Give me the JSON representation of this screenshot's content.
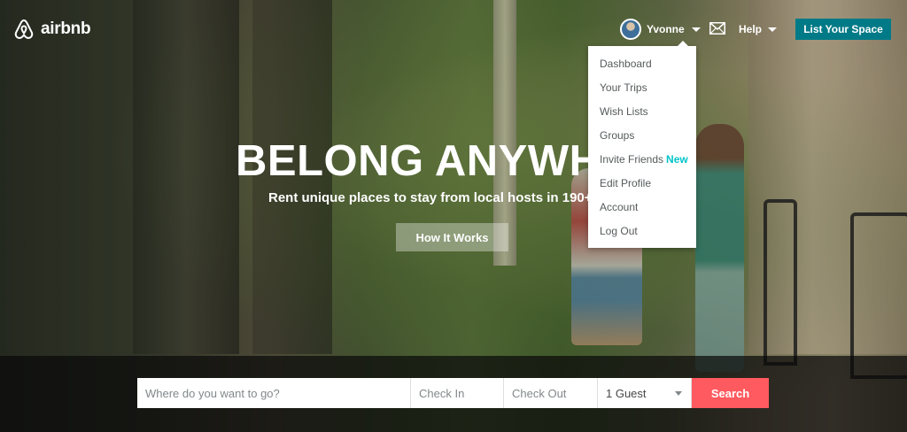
{
  "brand": {
    "name": "airbnb"
  },
  "header": {
    "user_name": "Yvonne",
    "help_label": "Help",
    "list_space_label": "List Your Space",
    "icons": {
      "user_caret": "caret-down-icon",
      "mail": "envelope-icon",
      "help_caret": "caret-down-icon"
    }
  },
  "user_menu": {
    "items": [
      {
        "label": "Dashboard"
      },
      {
        "label": "Your Trips"
      },
      {
        "label": "Wish Lists"
      },
      {
        "label": "Groups"
      },
      {
        "label": "Invite Friends",
        "badge": "New"
      },
      {
        "label": "Edit Profile"
      },
      {
        "label": "Account"
      },
      {
        "label": "Log Out"
      }
    ]
  },
  "hero": {
    "headline": "BELONG ANYWH",
    "subline": "Rent unique places to stay from local hosts in 190+ co",
    "how_it_works_label": "How It Works"
  },
  "search": {
    "where_placeholder": "Where do you want to go?",
    "check_in_placeholder": "Check In",
    "check_out_placeholder": "Check Out",
    "guests_value": "1 Guest",
    "search_label": "Search"
  },
  "colors": {
    "brand_teal": "#007a87",
    "search_red": "#ff5a5f",
    "new_badge": "#00c4c9"
  }
}
